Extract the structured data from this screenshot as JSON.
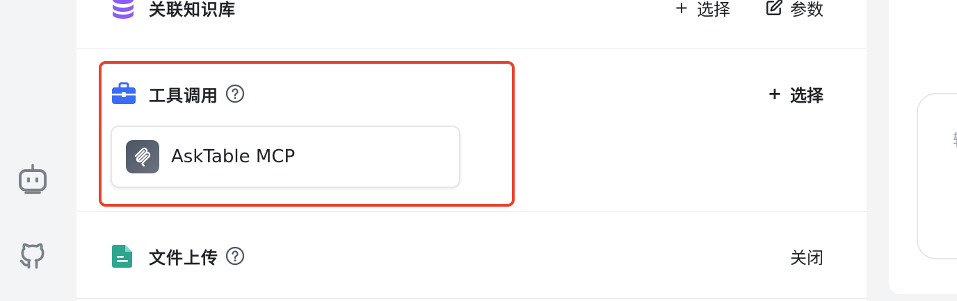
{
  "sections": {
    "knowledge": {
      "title": "关联知识库",
      "icon": "database-icon",
      "select_label": "选择",
      "params_label": "参数"
    },
    "tools": {
      "title": "工具调用",
      "icon": "toolbox-icon",
      "select_label": "选择",
      "items": [
        {
          "name": "AskTable MCP",
          "icon": "mcp-logo-icon"
        }
      ]
    },
    "file_upload": {
      "title": "文件上传",
      "icon": "document-icon",
      "status_label": "关闭"
    }
  },
  "right_panel": {
    "input_hint": "输"
  },
  "colors": {
    "highlight": "#e8432d",
    "knowledge_icon": "#8b5cf6",
    "tools_icon": "#3b6cf5",
    "file_icon": "#2ea58f"
  }
}
